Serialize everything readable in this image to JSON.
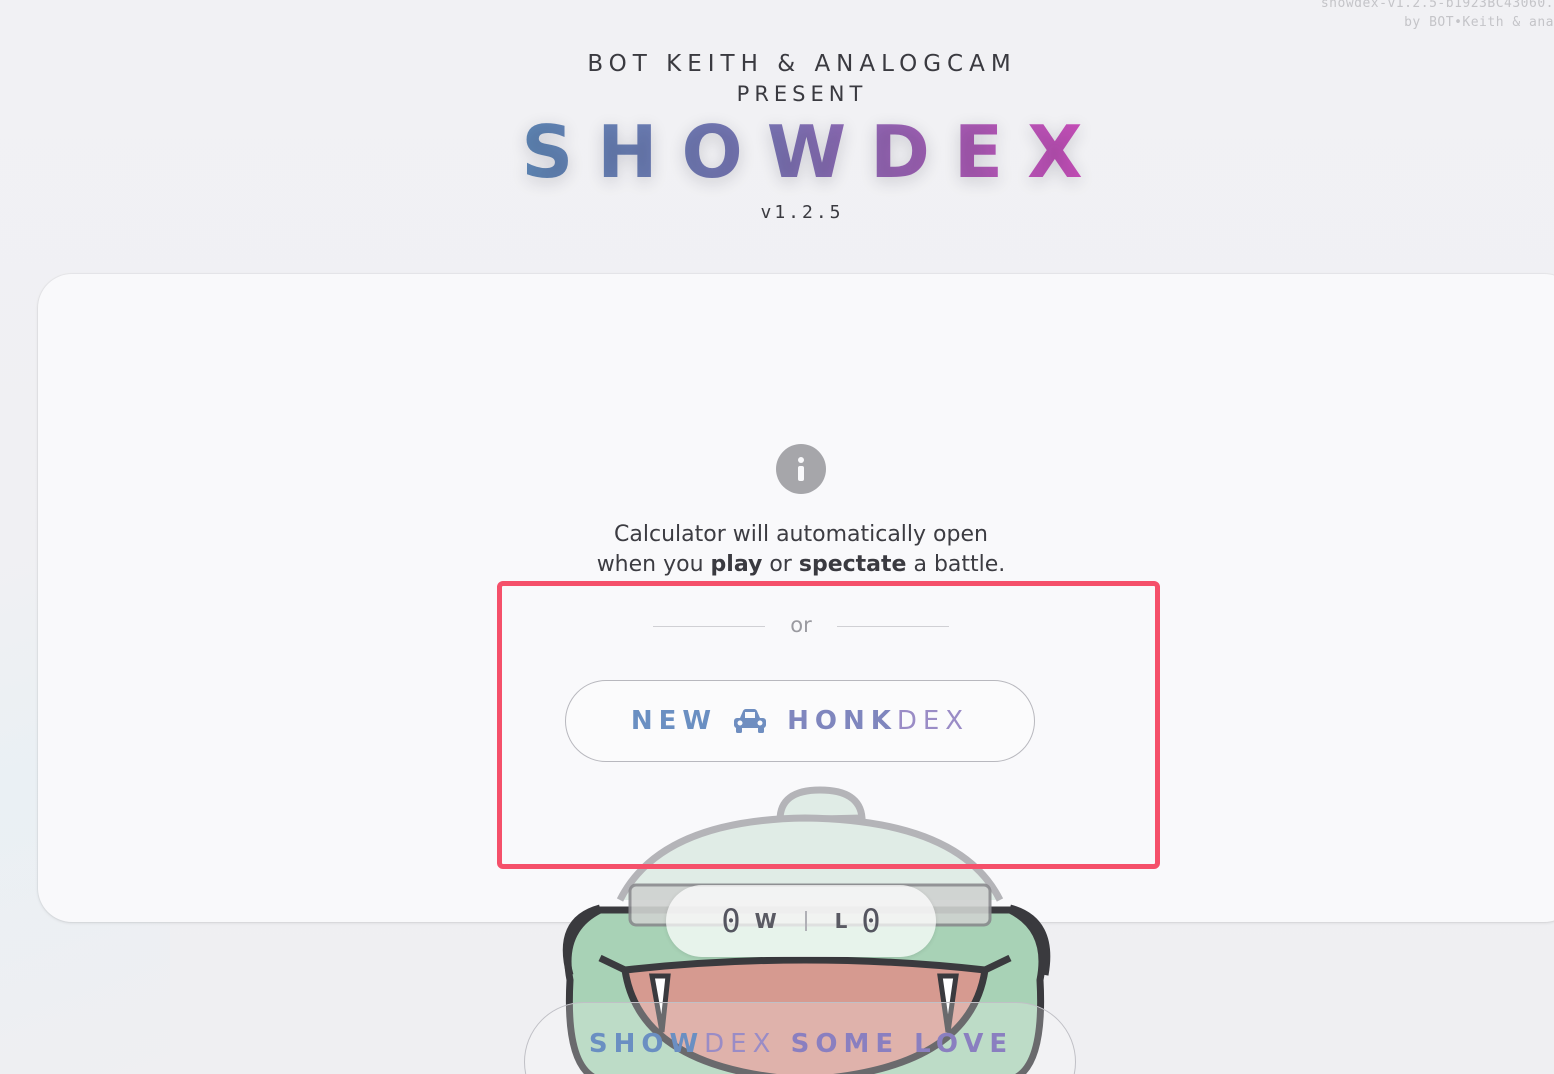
{
  "build_info": {
    "line1": "showdex-v1.2.5-b1923BC43060.",
    "line2": "by BOT•Keith & ana"
  },
  "header": {
    "presenters": "BOT KEITH & ANALOGCAM",
    "present": "PRESENT",
    "logo": "SHOWDEX",
    "version": "v1.2.5"
  },
  "info": {
    "message_line1": "Calculator will automatically open",
    "when_you": "when you",
    "play": "play",
    "or": "or",
    "spectate": "spectate",
    "a_battle": "a battle."
  },
  "divider": {
    "or_label": "or"
  },
  "new_button": {
    "new_label": "NEW",
    "honk_label": "HONK",
    "dex_label": "DEX",
    "icon": "car-icon"
  },
  "record": {
    "wins": "0",
    "wins_label": "W",
    "losses_label": "L",
    "losses": "0"
  },
  "love_button": {
    "show_label": "SHOW",
    "dex_label": "DEX",
    "some_love_label": "SOME LOVE"
  },
  "colors": {
    "highlight": "#f5506a",
    "accent_blue": "#6a8fc2",
    "accent_purple": "#9a8cc6",
    "logo_gradient_start": "#5b89b6",
    "logo_gradient_end": "#d04cbc"
  }
}
